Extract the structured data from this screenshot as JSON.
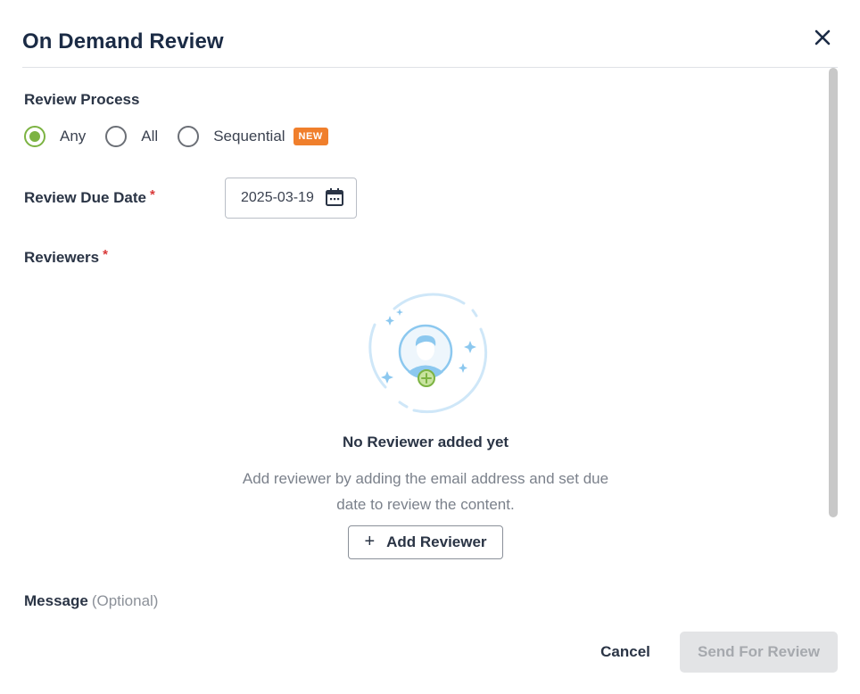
{
  "dialog": {
    "title": "On Demand Review",
    "close_icon": "close-icon"
  },
  "review_process": {
    "label": "Review Process",
    "options": [
      {
        "label": "Any",
        "selected": true
      },
      {
        "label": "All",
        "selected": false
      },
      {
        "label": "Sequential",
        "selected": false,
        "badge": "NEW"
      }
    ]
  },
  "due_date": {
    "label": "Review Due Date",
    "required_marker": "*",
    "value": "2025-03-19",
    "icon": "calendar-icon"
  },
  "reviewers": {
    "label": "Reviewers",
    "required_marker": "*",
    "empty_title": "No Reviewer added yet",
    "empty_description": "Add reviewer by adding the email address and set due date to review the content.",
    "add_button_icon": "+",
    "add_button_label": "Add Reviewer"
  },
  "message": {
    "label": "Message",
    "optional_text": "(Optional)"
  },
  "footer": {
    "cancel_label": "Cancel",
    "send_label": "Send For Review"
  },
  "colors": {
    "accent_green": "#7cb342",
    "badge_orange": "#f07f2c",
    "required_red": "#d93a3a",
    "illustration_blue": "#8cc8ef",
    "disabled_bg": "#e3e4e6"
  }
}
